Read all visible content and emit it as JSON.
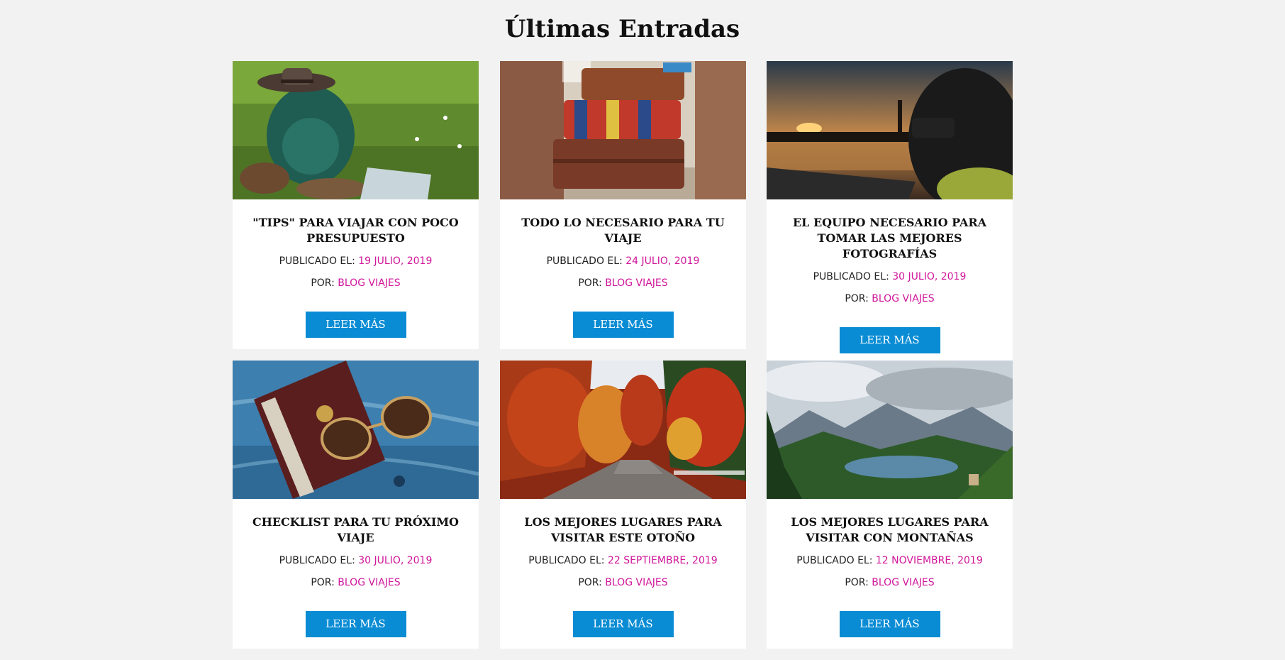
{
  "section": {
    "title": "Últimas Entradas"
  },
  "labels": {
    "published_prefix": "PUBLICADO EL:",
    "author_prefix": "POR:",
    "read_more": "LEER MÁS"
  },
  "colors": {
    "accent": "#d0169a",
    "button": "#0a8cd4",
    "background": "#f2f2f2"
  },
  "posts": [
    {
      "title": "\"TIPS\" PARA VIAJAR CON POCO PRESUPUESTO",
      "date": "19 JULIO, 2019",
      "author": "BLOG VIAJES",
      "image": "backpack-hat-boots-on-grass"
    },
    {
      "title": "TODO LO NECESARIO PARA TU VIAJE",
      "date": "24 JULIO, 2019",
      "author": "BLOG VIAJES",
      "image": "stacked-vintage-suitcases"
    },
    {
      "title": "EL EQUIPO NECESARIO PARA TOMAR LAS MEJORES FOTOGRAFÍAS",
      "date": "30 JULIO, 2019",
      "author": "BLOG VIAJES",
      "image": "photographer-at-sunset-river"
    },
    {
      "title": "CHECKLIST PARA TU PRÓXIMO VIAJE",
      "date": "30 JULIO, 2019",
      "author": "BLOG VIAJES",
      "image": "passport-sunglasses-denim"
    },
    {
      "title": "LOS MEJORES LUGARES PARA VISITAR ESTE OTOÑO",
      "date": "22 SEPTIEMBRE, 2019",
      "author": "BLOG VIAJES",
      "image": "autumn-forest-road"
    },
    {
      "title": "LOS MEJORES LUGARES PARA VISITAR CON MONTAÑAS",
      "date": "12 NOVIEMBRE, 2019",
      "author": "BLOG VIAJES",
      "image": "mountain-lake-landscape"
    }
  ]
}
